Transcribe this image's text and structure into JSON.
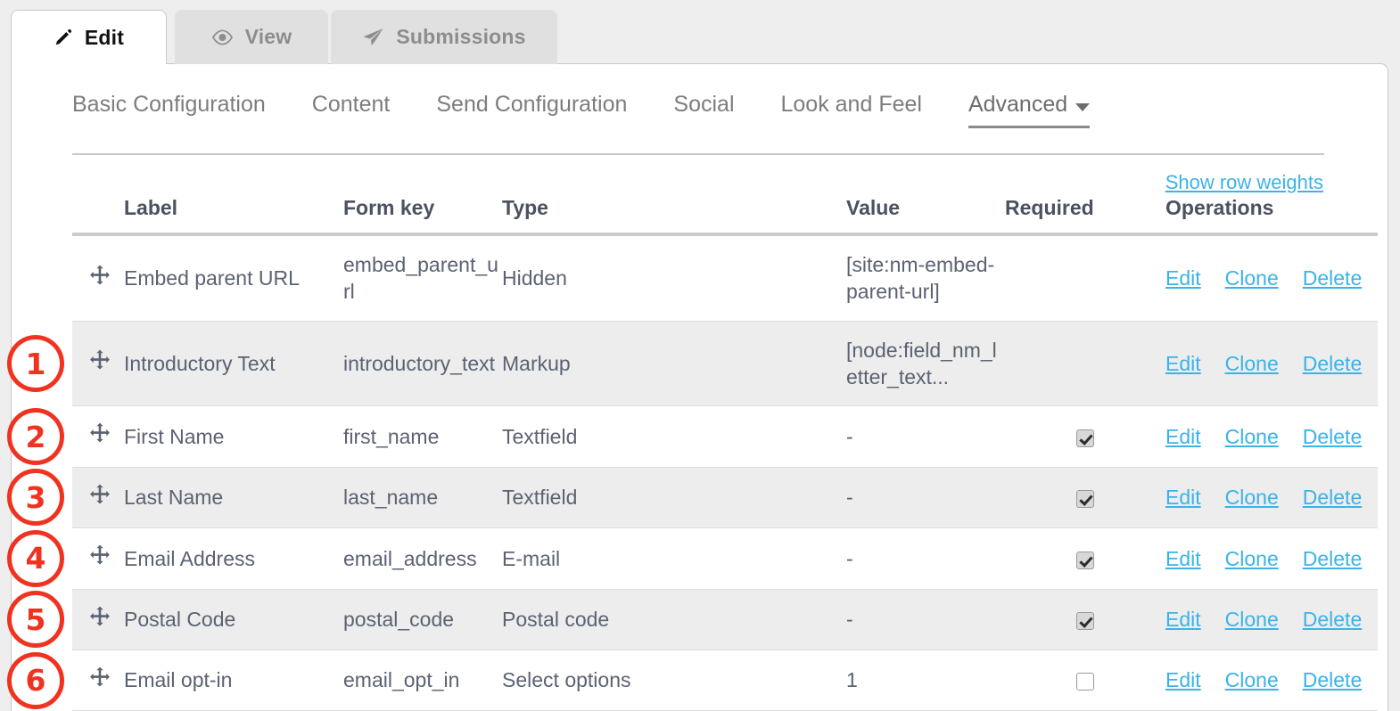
{
  "primary_tabs": [
    {
      "label": "Edit",
      "icon": "pencil-icon",
      "active": true
    },
    {
      "label": "View",
      "icon": "eye-icon",
      "active": false
    },
    {
      "label": "Submissions",
      "icon": "paper-plane-icon",
      "active": false
    }
  ],
  "sub_nav": [
    {
      "label": "Basic Configuration",
      "current": false,
      "caret": false
    },
    {
      "label": "Content",
      "current": false,
      "caret": false
    },
    {
      "label": "Send Configuration",
      "current": false,
      "caret": false
    },
    {
      "label": "Social",
      "current": false,
      "caret": false
    },
    {
      "label": "Look and Feel",
      "current": false,
      "caret": false
    },
    {
      "label": "Advanced",
      "current": true,
      "caret": true
    }
  ],
  "show_row_weights": "Show row weights",
  "table": {
    "headers": {
      "handle": "",
      "label": "Label",
      "form_key": "Form key",
      "type": "Type",
      "value": "Value",
      "required": "Required",
      "operations": "Operations"
    },
    "operation_labels": {
      "edit": "Edit",
      "clone": "Clone",
      "delete": "Delete"
    },
    "rows": [
      {
        "annotation": "",
        "label": "Embed parent URL",
        "form_key": "embed_parent_url",
        "type": "Hidden",
        "value": "[site:nm-embed-parent-url]",
        "required": false,
        "required_shown": false,
        "alt": false
      },
      {
        "annotation": "1",
        "label": "Introductory Text",
        "form_key": "introductory_text",
        "type": "Markup",
        "value": "[node:field_nm_letter_text...",
        "required": false,
        "required_shown": false,
        "alt": true
      },
      {
        "annotation": "2",
        "label": "First Name",
        "form_key": "first_name",
        "type": "Textfield",
        "value": "-",
        "required": true,
        "required_shown": true,
        "alt": false
      },
      {
        "annotation": "3",
        "label": "Last Name",
        "form_key": "last_name",
        "type": "Textfield",
        "value": "-",
        "required": true,
        "required_shown": true,
        "alt": true
      },
      {
        "annotation": "4",
        "label": "Email Address",
        "form_key": "email_address",
        "type": "E-mail",
        "value": "-",
        "required": true,
        "required_shown": true,
        "alt": false
      },
      {
        "annotation": "5",
        "label": "Postal Code",
        "form_key": "postal_code",
        "type": "Postal code",
        "value": "-",
        "required": true,
        "required_shown": true,
        "alt": true
      },
      {
        "annotation": "6",
        "label": "Email opt-in",
        "form_key": "email_opt_in",
        "type": "Select options",
        "value": "1",
        "required": false,
        "required_shown": true,
        "alt": false
      }
    ]
  },
  "colors": {
    "link": "#3bb3e8",
    "annotation": "#f03320",
    "text": "#5b6272",
    "header_text": "#4a5160",
    "row_alt": "#ededed",
    "page_bg": "#eeeeee"
  }
}
